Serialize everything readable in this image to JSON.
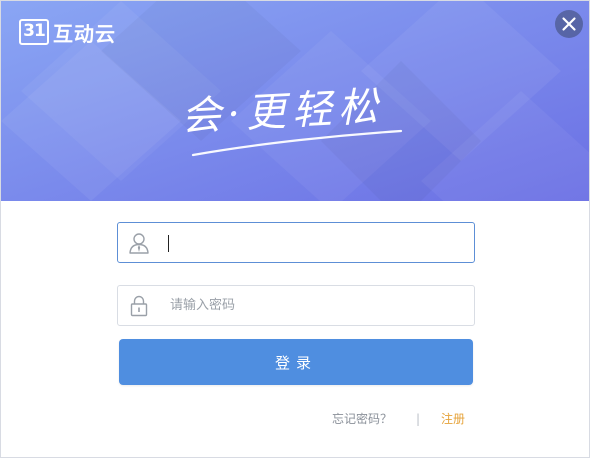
{
  "colors": {
    "banner_gradient_start": "#8aa2f2",
    "banner_gradient_end": "#6e74e6",
    "primary_button": "#4f8ee0",
    "register_link": "#e6a33a",
    "focus_border": "#5d8fd6"
  },
  "header": {
    "logo_mark": "31",
    "logo_text": "互动云",
    "slogan": "会·更轻松",
    "close_icon": "close-icon"
  },
  "form": {
    "username": {
      "icon": "user-icon",
      "value": "",
      "placeholder": ""
    },
    "password": {
      "icon": "lock-icon",
      "value": "",
      "placeholder": "请输入密码"
    },
    "login_label": "登录"
  },
  "links": {
    "forgot_password": "忘记密码？",
    "separator": "|",
    "register": "注册"
  }
}
